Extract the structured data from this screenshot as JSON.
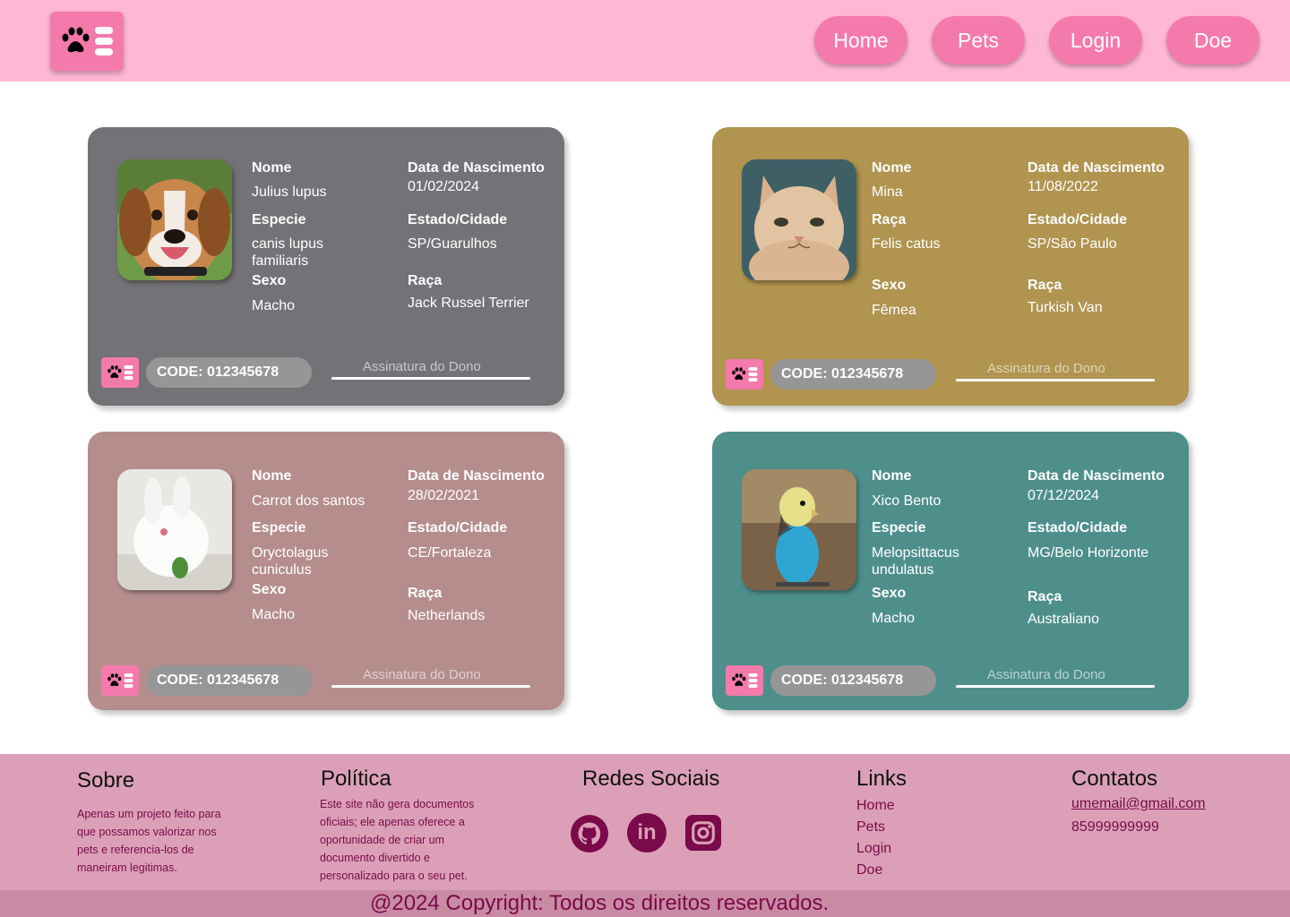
{
  "header": {
    "nav": [
      "Home",
      "Pets",
      "Login",
      "Doe"
    ]
  },
  "card_labels": {
    "name": "Nome",
    "birth": "Data de Nascimento",
    "state": "Estado/Cidade",
    "sex": "Sexo",
    "breed": "Raça",
    "species": "Especie",
    "signature": "Assinatura do Dono"
  },
  "cards": [
    {
      "color": "#737277",
      "name": "Julius lupus",
      "birth": "01/02/2024",
      "label2": "Especie",
      "species": "canis lupus familiaris",
      "state": "SP/Guarulhos",
      "sex": "Macho",
      "breed": "Jack Russel Terrier",
      "code": "CODE: 012345678"
    },
    {
      "color": "#b0944f",
      "name": "Mina",
      "birth": "11/08/2022",
      "label2": "Raça",
      "species": "Felis catus",
      "state": "SP/São Paulo",
      "sex": "Fêmea",
      "breed": "Turkish Van",
      "code": "CODE: 012345678"
    },
    {
      "color": "#b58d8d",
      "name": "Carrot dos santos",
      "birth": "28/02/2021",
      "label2": "Especie",
      "species": "Oryctolagus cuniculus",
      "state": "CE/Fortaleza",
      "sex": "Macho",
      "breed": "Netherlands",
      "code": "CODE: 012345678"
    },
    {
      "color": "#4e8f8c",
      "name": "Xico Bento",
      "birth": "07/12/2024",
      "label2": "Especie",
      "species": "Melopsittacus undulatus",
      "state": "MG/Belo Horizonte",
      "sex": "Macho",
      "breed": "Australiano",
      "code": "CODE: 012345678"
    }
  ],
  "footer": {
    "about_title": "Sobre",
    "about_text": "Apenas um projeto feito para que possamos valorizar nos pets e referencia-los de maneiram legitimas.",
    "policy_title": "Política",
    "policy_text": "Este site não gera documentos oficiais; ele apenas oferece a oportunidade de criar um documento divertido e personalizado para o seu pet.",
    "social_title": "Redes Sociais",
    "social_icons": [
      "github-icon",
      "linkedin-icon",
      "instagram-icon"
    ],
    "links_title": "Links",
    "links": [
      "Home",
      "Pets",
      "Login",
      "Doe"
    ],
    "contacts_title": "Contatos",
    "email": "umemail@gmail.com",
    "phone": "85999999999",
    "copyright": "@2024 Copyright: Todos os direitos reservados."
  },
  "colors": {
    "header_bg": "#ffb7d4",
    "accent_pink": "#f47aac",
    "footer_bg": "#dba0b7",
    "footer_text": "#7a0a4a"
  }
}
